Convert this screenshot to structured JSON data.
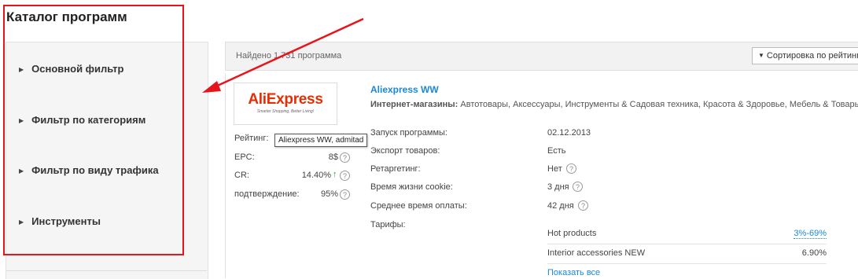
{
  "page": {
    "title": "Каталог программ"
  },
  "sidebar": {
    "items": [
      {
        "label": "Основной фильтр"
      },
      {
        "label": "Фильтр по категориям"
      },
      {
        "label": "Фильтр по виду трафика"
      },
      {
        "label": "Инструменты"
      }
    ]
  },
  "results": {
    "found_text": "Найдено 1 731 программа",
    "sort_label": "Сортировка по рейтингу"
  },
  "program": {
    "logo": {
      "text": "AliExpress",
      "tagline": "Smarter Shopping, Better Living!"
    },
    "title": "Aliexpress WW",
    "categories_label": "Интернет-магазины:",
    "categories_text": "Автотовары, Аксессуары, Инструменты & Садовая техника, Красота & Здоровье, Мебель & Товары",
    "tooltip": "Aliexpress WW, admitad",
    "stats": {
      "rating_label": "Рейтинг:",
      "epc_label": "EPC:",
      "epc_value": "8$",
      "cr_label": "CR:",
      "cr_value": "14.40%",
      "confirm_label": "подтверждение:",
      "confirm_value": "95%"
    },
    "info": {
      "launch_label": "Запуск программы:",
      "launch_value": "02.12.2013",
      "export_label": "Экспорт товаров:",
      "export_value": "Есть",
      "retarget_label": "Ретаргетинг:",
      "retarget_value": "Нет",
      "cookie_label": "Время жизни cookie:",
      "cookie_value": "3 дня",
      "payout_label": "Среднее время оплаты:",
      "payout_value": "42 дня",
      "tariffs_label": "Тарифы:"
    },
    "tariffs": [
      {
        "name": "Hot products",
        "value": "3%-69%"
      },
      {
        "name": "Interior accessories NEW",
        "value": "6.90%"
      }
    ],
    "show_all": "Показать все"
  },
  "colors": {
    "accent_blue": "#1a88d8",
    "annotation_red": "#e8141b",
    "logo_orange": "#e62e04",
    "positive_green": "#2e9d3a"
  }
}
